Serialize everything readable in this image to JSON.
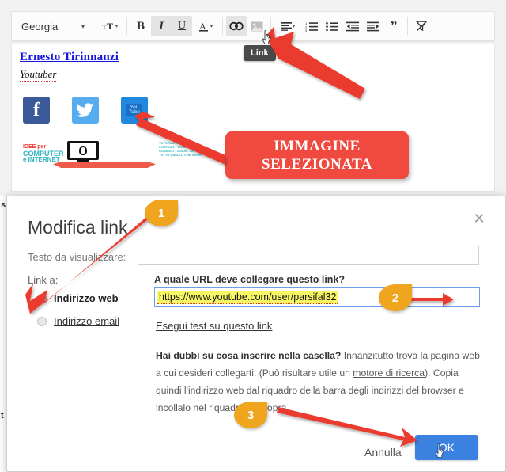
{
  "toolbar": {
    "font_name": "Georgia",
    "caret": "▾",
    "buttons": [
      {
        "name": "font-size-icon",
        "label": "T"
      },
      {
        "name": "bold-button",
        "label": "B"
      },
      {
        "name": "italic-button",
        "label": "I"
      },
      {
        "name": "underline-button",
        "label": "U"
      },
      {
        "name": "text-color-button",
        "label": "A"
      },
      {
        "name": "link-button",
        "label": "link"
      },
      {
        "name": "image-button",
        "label": "image"
      },
      {
        "name": "align-button",
        "label": "align"
      },
      {
        "name": "numbered-list-button",
        "label": "numbered-list"
      },
      {
        "name": "bullet-list-button",
        "label": "bullet-list"
      },
      {
        "name": "outdent-button",
        "label": "outdent"
      },
      {
        "name": "indent-button",
        "label": "indent"
      },
      {
        "name": "quote-button",
        "label": "quote"
      },
      {
        "name": "clear-format-button",
        "label": "clear"
      }
    ],
    "tooltip": "Link"
  },
  "document": {
    "signature_name": "Ernesto Tirinnanzi",
    "signature_role": "Youtuber",
    "social": [
      {
        "name": "facebook-icon",
        "glyph": "f"
      },
      {
        "name": "twitter-icon",
        "glyph": "🐦"
      },
      {
        "name": "youtube-icon",
        "glyph": "You Tube"
      }
    ],
    "banner": {
      "line1": "IDEE per",
      "line2": "COMPUTER",
      "line3": "e INTERNET",
      "side_text": "TUTORIAL SU PC E SU INTERNET - TRUCCHI - CONSIGLI - GUIDE - APP IN TUTTO QUELLO CHE SERVE"
    }
  },
  "callout": {
    "line1": "IMMAGINE",
    "line2": "SELEZIONATA"
  },
  "dialog": {
    "title": "Modifica link",
    "close": "✕",
    "display_text_label": "Testo da visualizzare:",
    "display_text_value": "",
    "link_to_label": "Link a:",
    "radio_web": "Indirizzo web",
    "radio_email": "Indirizzo email",
    "url_question": "A quale URL deve collegare questo link?",
    "url_value": "https://www.youtube.com/user/parsifal32",
    "test_link": "Esegui test su questo link",
    "help_bold": "Hai dubbi su cosa inserire nella casella?",
    "help_part1": " Innanzitutto trova la pagina web a cui desideri collegarti. (Può risultare utile un ",
    "help_link": "motore di ricerca",
    "help_part2": "). Copia quindi l'indirizzo web dal riquadro della barra degli indirizzi del browser e incollalo nel riquadro qui sopra.",
    "cancel_label": "Annulla",
    "ok_label": "OK"
  },
  "annotations": {
    "badge1": "1",
    "badge2": "2",
    "badge3": "3"
  },
  "background_slivers": {
    "top": "s",
    "bottom": "t"
  },
  "colors": {
    "accent_red": "#f04a40",
    "badge_orange": "#f0a51e",
    "ok_blue": "#3b82e0",
    "link_blue": "#1414dd",
    "highlight_yellow": "#f6f763"
  }
}
